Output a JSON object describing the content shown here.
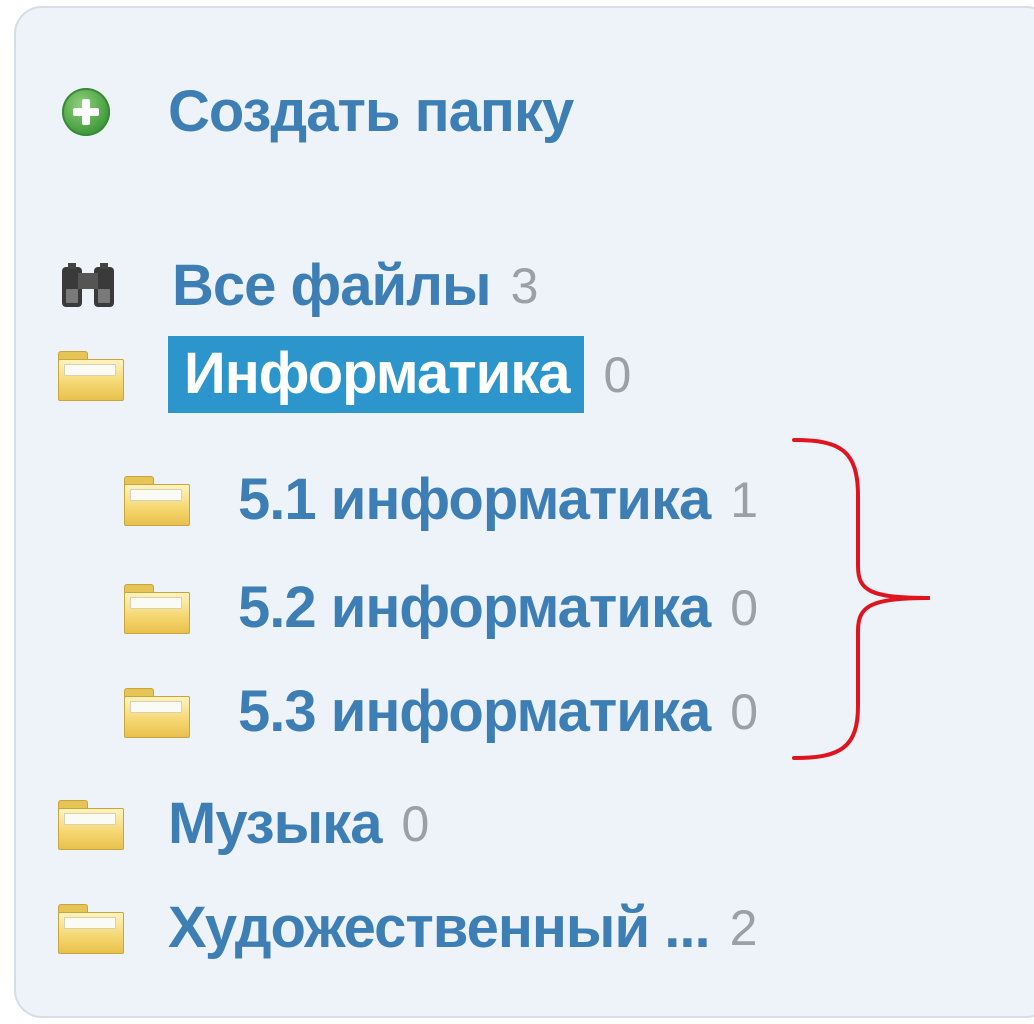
{
  "create_folder": {
    "label": "Создать папку",
    "icon": "plus-circle-icon"
  },
  "folders": [
    {
      "label": "Все файлы",
      "count": "3",
      "icon": "binoculars-icon"
    },
    {
      "label": "Информатика",
      "count": "0",
      "icon": "folder-icon",
      "selected": true
    },
    {
      "label": "5.1 информатика",
      "count": "1",
      "icon": "folder-icon"
    },
    {
      "label": "5.2 информатика",
      "count": "0",
      "icon": "folder-icon"
    },
    {
      "label": "5.3 информатика",
      "count": "0",
      "icon": "folder-icon"
    },
    {
      "label": "Музыка",
      "count": "0",
      "icon": "folder-icon"
    },
    {
      "label": "Художественный ...",
      "count": "2",
      "icon": "folder-icon"
    }
  ],
  "colors": {
    "link": "#3d7fb5",
    "count": "#9aa0a6",
    "selected_bg": "#2b95cc",
    "panel_bg": "#eef3f9",
    "bracket": "#e0141e"
  }
}
